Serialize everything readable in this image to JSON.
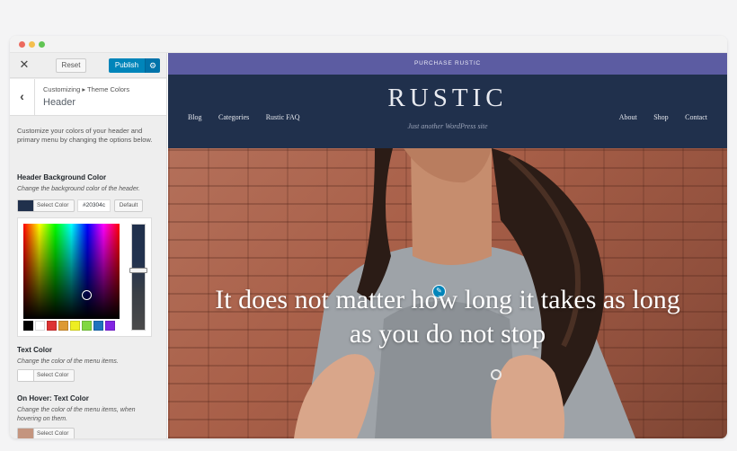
{
  "panel": {
    "reset_label": "Reset",
    "publish_label": "Publish",
    "breadcrumb": "Customizing ▸ Theme Colors",
    "section_title": "Header",
    "description": "Customize your colors of your header and primary menu by changing the options below.",
    "controls": [
      {
        "title": "Header Background Color",
        "desc": "Change the background color of the header.",
        "button_label": "Select Color",
        "swatch_color": "#20304c",
        "hex_value": "#20304c",
        "default_label": "Default"
      },
      {
        "title": "Text Color",
        "desc": "Change the color of the menu items.",
        "button_label": "Select Color",
        "swatch_color": "#ffffff"
      },
      {
        "title": "On Hover: Text Color",
        "desc": "Change the color of the menu items, when hovering on them.",
        "button_label": "Select Color",
        "swatch_color": "#c4957f"
      }
    ],
    "palette_colors": [
      "#000000",
      "#ffffff",
      "#dd3333",
      "#dd9933",
      "#eeee22",
      "#81d742",
      "#1e73be",
      "#8224e3"
    ]
  },
  "preview": {
    "promo_text": "PURCHASE RUSTIC",
    "nav_left": [
      "Blog",
      "Categories",
      "Rustic FAQ"
    ],
    "nav_right": [
      "About",
      "Shop",
      "Contact"
    ],
    "site_title": "RUSTIC",
    "tagline": "Just another WordPress site",
    "headline": "It does not matter how long it takes as long as you do not stop",
    "header_color": "#20304c",
    "promo_color": "#5c5ca2"
  }
}
